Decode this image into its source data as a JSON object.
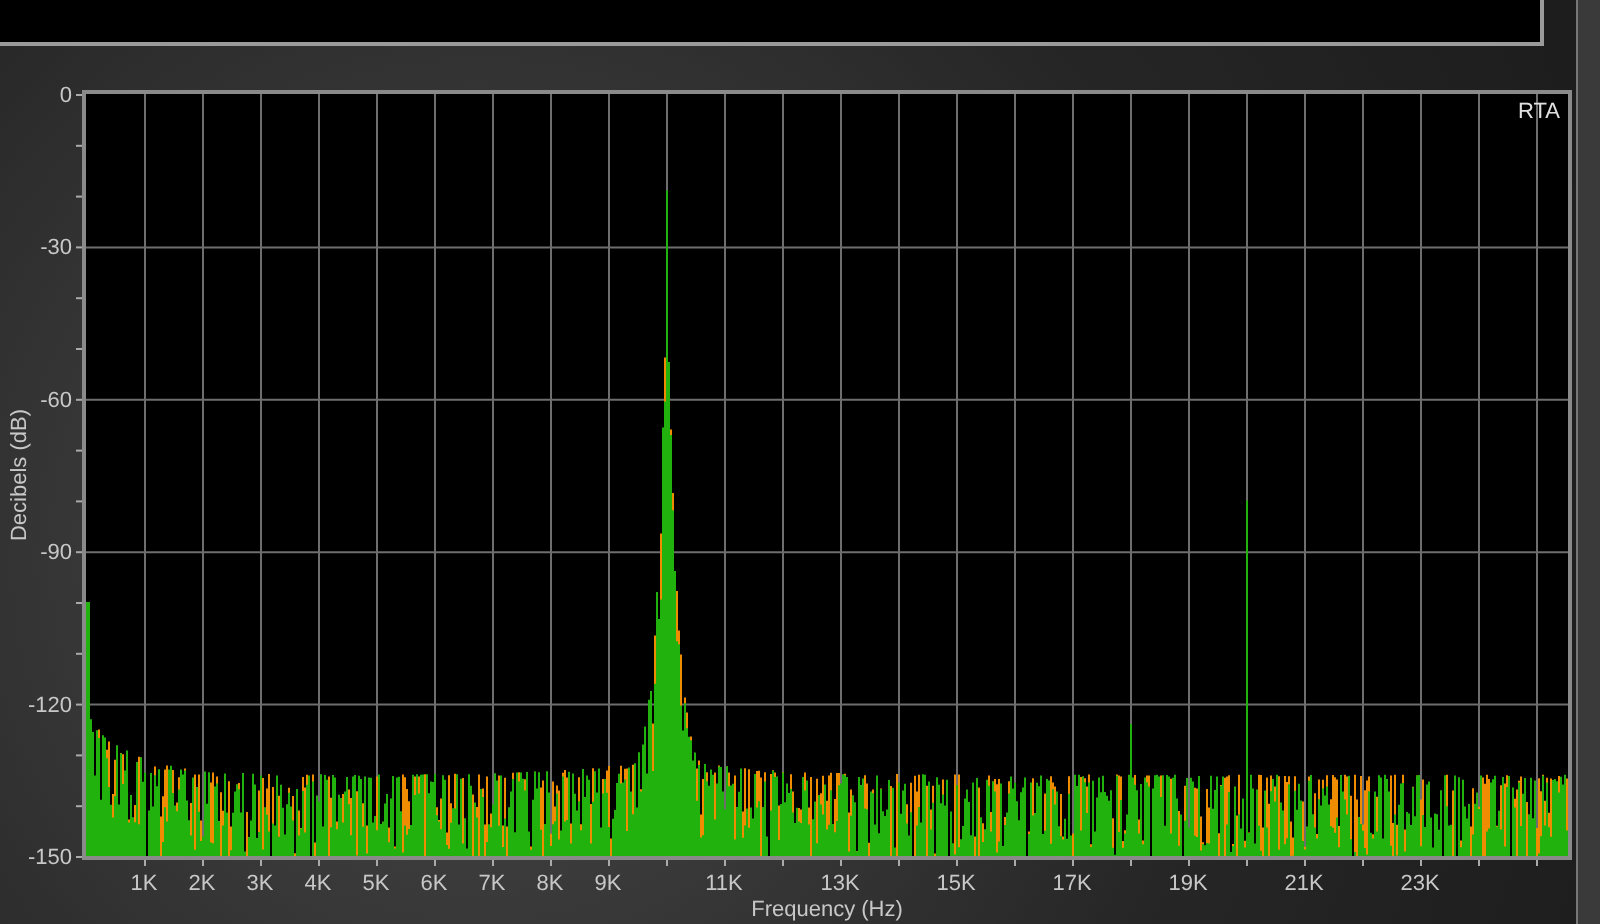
{
  "plot": {
    "corner_label": "RTA",
    "y_axis": {
      "title": "Decibels (dB)",
      "ticks": [
        "0",
        "-30",
        "-60",
        "-90",
        "-120",
        "-150"
      ]
    },
    "x_axis": {
      "title": "Frequency (Hz)",
      "ticks": [
        "1K",
        "2K",
        "3K",
        "4K",
        "5K",
        "6K",
        "7K",
        "8K",
        "9K",
        "11K",
        "13K",
        "15K",
        "17K",
        "19K",
        "21K",
        "23K"
      ]
    }
  }
}
